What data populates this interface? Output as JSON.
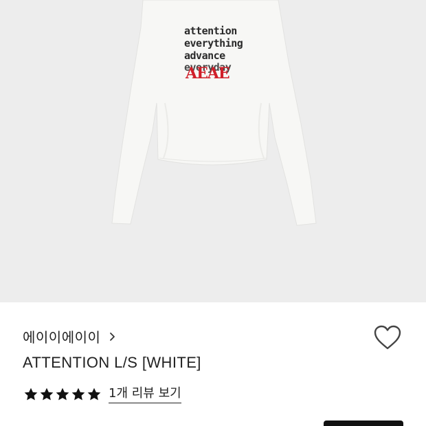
{
  "product": {
    "image_alt": "",
    "print_lines": [
      "attention",
      "everything",
      "advance",
      "everyday"
    ],
    "print_logo": "AEAE",
    "colors": {
      "background": "#ededed",
      "garment": "#f7f7f5",
      "print_text": "#2a2a2a",
      "logo_red": "#d11f2a"
    }
  },
  "info": {
    "brand": "에이이에이이",
    "title": "ATTENTION L/S [WHITE]",
    "rating": {
      "stars": 5,
      "max": 5
    },
    "review_link": "1개 리뷰 보기",
    "icons": {
      "brand_chevron": "chevron-right-icon",
      "wishlist": "heart-outline-icon",
      "rating": "star-icon"
    }
  }
}
